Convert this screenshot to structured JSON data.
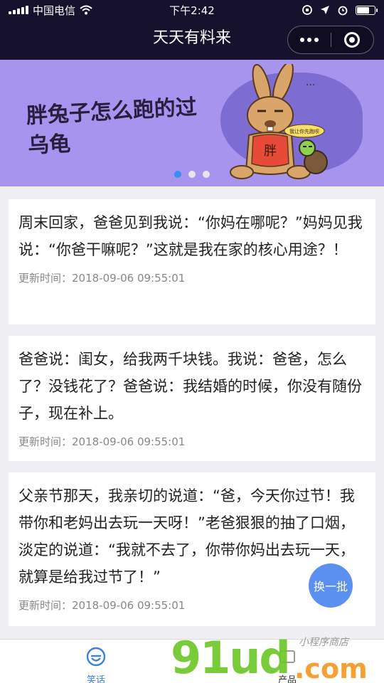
{
  "status_bar": {
    "carrier": "中国电信",
    "time": "下午2:42",
    "battery_level": 0.75
  },
  "nav": {
    "title": "天天有料来"
  },
  "banner": {
    "title_line1": "胖兔子怎么跑的过",
    "title_line2": "乌龟",
    "shirt_text": "胖",
    "speech_text": "我让你先跑呗",
    "dots_count": 3,
    "active_dot": 0
  },
  "jokes": [
    {
      "text": "周末回家，爸爸见到我说：“你妈在哪呢？”妈妈见我说：“你爸干嘛呢？”这就是我在家的核心用途？！",
      "time_label": "更新时间：",
      "time": "2018-09-06 09:55:01"
    },
    {
      "text": "爸爸说：闺女，给我两千块钱。我说：爸爸，怎么了？没钱花了？爸爸说：我结婚的时候，你没有随份子，现在补上。",
      "time_label": "更新时间：",
      "time": "2018-09-06 09:55:01"
    },
    {
      "text": "父亲节那天，我亲切的说道：“爸，今天你过节！我带你和老妈出去玩一天呀！”老爸狠狠的抽了口烟，淡定的说道：“我就不去了，你带你妈出去玩一天，就算是给我过节了！”",
      "time_label": "更新时间：",
      "time": "2018-09-06 09:55:01"
    }
  ],
  "refresh_button": {
    "label": "换一批"
  },
  "tabs": [
    {
      "label": "笑话",
      "icon": "smiley-icon",
      "active": true
    },
    {
      "label": "产品",
      "icon": "product-icon",
      "active": false
    }
  ],
  "watermark": {
    "main": "91ud",
    "com": ".com",
    "sub": "小程序商店"
  },
  "colors": {
    "nav_bg": "#16122e",
    "banner_bg": "#a694ee",
    "accent": "#3b8ef0",
    "button": "#5b8ff0"
  }
}
